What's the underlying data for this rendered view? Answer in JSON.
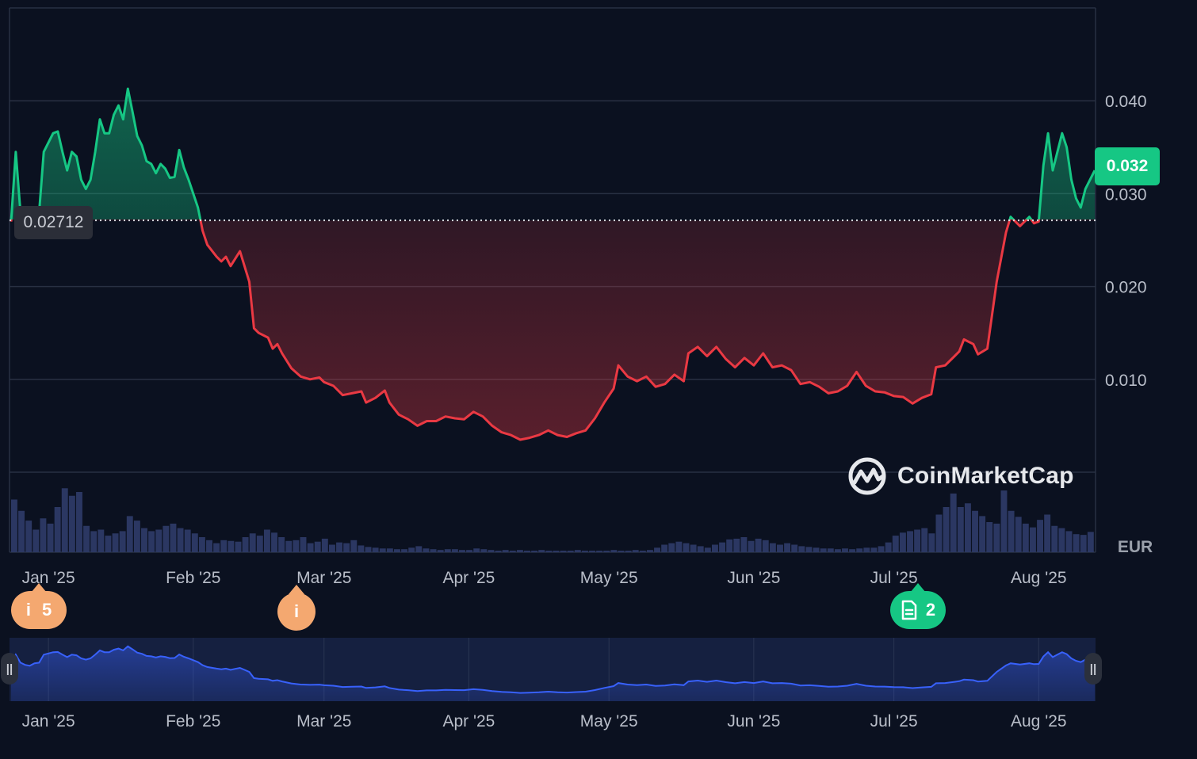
{
  "chart_data": {
    "type": "line",
    "title": "",
    "xlabel": "",
    "ylabel": "",
    "unit_label": "EUR",
    "ylim": [
      0,
      0.05
    ],
    "y_ticks": [
      "0.040",
      "0.030",
      "0.020",
      "0.010"
    ],
    "y_tick_values": [
      0.04,
      0.03,
      0.02,
      0.01
    ],
    "x_start": "2024-12-24",
    "x_end": "2025-08-13",
    "month_labels": [
      {
        "label": "Jan '25",
        "date": "2025-01-01"
      },
      {
        "label": "Feb '25",
        "date": "2025-02-01"
      },
      {
        "label": "Mar '25",
        "date": "2025-03-01"
      },
      {
        "label": "Apr '25",
        "date": "2025-04-01"
      },
      {
        "label": "May '25",
        "date": "2025-05-01"
      },
      {
        "label": "Jun '25",
        "date": "2025-06-01"
      },
      {
        "label": "Jul '25",
        "date": "2025-07-01"
      },
      {
        "label": "Aug '25",
        "date": "2025-08-01"
      }
    ],
    "baseline": {
      "value": 0.02712,
      "label": "0.02712"
    },
    "current_price": {
      "value": 0.0322,
      "label": "0.032"
    },
    "colors": {
      "up": "#16c784",
      "down": "#ea3943",
      "navigator": "#3861fb",
      "background": "#0b1120",
      "grid": "#283042"
    },
    "series": [
      {
        "points": [
          [
            "2024-12-24",
            0.027
          ],
          [
            "2024-12-25",
            0.0345
          ],
          [
            "2024-12-26",
            0.028
          ],
          [
            "2024-12-27",
            0.0262
          ],
          [
            "2024-12-28",
            0.0255
          ],
          [
            "2024-12-29",
            0.0275
          ],
          [
            "2024-12-30",
            0.028
          ],
          [
            "2024-12-31",
            0.0345
          ],
          [
            "2025-01-02",
            0.0365
          ],
          [
            "2025-01-03",
            0.0367
          ],
          [
            "2025-01-04",
            0.0345
          ],
          [
            "2025-01-05",
            0.0325
          ],
          [
            "2025-01-06",
            0.0345
          ],
          [
            "2025-01-07",
            0.034
          ],
          [
            "2025-01-08",
            0.0315
          ],
          [
            "2025-01-09",
            0.0305
          ],
          [
            "2025-01-10",
            0.0315
          ],
          [
            "2025-01-11",
            0.0345
          ],
          [
            "2025-01-12",
            0.038
          ],
          [
            "2025-01-13",
            0.0365
          ],
          [
            "2025-01-14",
            0.0365
          ],
          [
            "2025-01-15",
            0.0385
          ],
          [
            "2025-01-16",
            0.0395
          ],
          [
            "2025-01-17",
            0.038
          ],
          [
            "2025-01-18",
            0.0413
          ],
          [
            "2025-01-19",
            0.0388
          ],
          [
            "2025-01-20",
            0.0362
          ],
          [
            "2025-01-21",
            0.0352
          ],
          [
            "2025-01-22",
            0.0335
          ],
          [
            "2025-01-23",
            0.0332
          ],
          [
            "2025-01-24",
            0.0322
          ],
          [
            "2025-01-25",
            0.0332
          ],
          [
            "2025-01-26",
            0.0327
          ],
          [
            "2025-01-27",
            0.0317
          ],
          [
            "2025-01-28",
            0.0318
          ],
          [
            "2025-01-29",
            0.0347
          ],
          [
            "2025-01-30",
            0.0328
          ],
          [
            "2025-01-31",
            0.0315
          ],
          [
            "2025-02-02",
            0.0285
          ],
          [
            "2025-02-03",
            0.026
          ],
          [
            "2025-02-04",
            0.0245
          ],
          [
            "2025-02-06",
            0.0232
          ],
          [
            "2025-02-07",
            0.0227
          ],
          [
            "2025-02-08",
            0.0232
          ],
          [
            "2025-02-09",
            0.0222
          ],
          [
            "2025-02-10",
            0.023
          ],
          [
            "2025-02-11",
            0.0238
          ],
          [
            "2025-02-13",
            0.0205
          ],
          [
            "2025-02-14",
            0.0155
          ],
          [
            "2025-02-15",
            0.015
          ],
          [
            "2025-02-17",
            0.0145
          ],
          [
            "2025-02-18",
            0.0133
          ],
          [
            "2025-02-19",
            0.0138
          ],
          [
            "2025-02-20",
            0.0128
          ],
          [
            "2025-02-22",
            0.0112
          ],
          [
            "2025-02-24",
            0.0103
          ],
          [
            "2025-02-26",
            0.01
          ],
          [
            "2025-02-28",
            0.0102
          ],
          [
            "2025-03-01",
            0.0097
          ],
          [
            "2025-03-03",
            0.0093
          ],
          [
            "2025-03-05",
            0.0083
          ],
          [
            "2025-03-07",
            0.0085
          ],
          [
            "2025-03-09",
            0.0087
          ],
          [
            "2025-03-10",
            0.0075
          ],
          [
            "2025-03-12",
            0.008
          ],
          [
            "2025-03-14",
            0.0088
          ],
          [
            "2025-03-15",
            0.0075
          ],
          [
            "2025-03-17",
            0.0062
          ],
          [
            "2025-03-19",
            0.0057
          ],
          [
            "2025-03-21",
            0.005
          ],
          [
            "2025-03-23",
            0.0055
          ],
          [
            "2025-03-25",
            0.0055
          ],
          [
            "2025-03-27",
            0.006
          ],
          [
            "2025-03-29",
            0.0058
          ],
          [
            "2025-03-31",
            0.0057
          ],
          [
            "2025-04-02",
            0.0065
          ],
          [
            "2025-04-04",
            0.006
          ],
          [
            "2025-04-06",
            0.005
          ],
          [
            "2025-04-08",
            0.0043
          ],
          [
            "2025-04-10",
            0.004
          ],
          [
            "2025-04-12",
            0.0035
          ],
          [
            "2025-04-14",
            0.0037
          ],
          [
            "2025-04-16",
            0.004
          ],
          [
            "2025-04-18",
            0.0045
          ],
          [
            "2025-04-20",
            0.004
          ],
          [
            "2025-04-22",
            0.0038
          ],
          [
            "2025-04-24",
            0.0042
          ],
          [
            "2025-04-26",
            0.0045
          ],
          [
            "2025-04-28",
            0.0058
          ],
          [
            "2025-04-30",
            0.0075
          ],
          [
            "2025-05-02",
            0.009
          ],
          [
            "2025-05-03",
            0.0115
          ],
          [
            "2025-05-05",
            0.0103
          ],
          [
            "2025-05-07",
            0.0098
          ],
          [
            "2025-05-09",
            0.0103
          ],
          [
            "2025-05-11",
            0.0092
          ],
          [
            "2025-05-13",
            0.0095
          ],
          [
            "2025-05-15",
            0.0105
          ],
          [
            "2025-05-17",
            0.0098
          ],
          [
            "2025-05-18",
            0.0128
          ],
          [
            "2025-05-20",
            0.0135
          ],
          [
            "2025-05-22",
            0.0125
          ],
          [
            "2025-05-24",
            0.0135
          ],
          [
            "2025-05-26",
            0.0122
          ],
          [
            "2025-05-28",
            0.0113
          ],
          [
            "2025-05-30",
            0.0123
          ],
          [
            "2025-06-01",
            0.0115
          ],
          [
            "2025-06-03",
            0.0128
          ],
          [
            "2025-06-05",
            0.0113
          ],
          [
            "2025-06-07",
            0.0115
          ],
          [
            "2025-06-09",
            0.011
          ],
          [
            "2025-06-11",
            0.0095
          ],
          [
            "2025-06-13",
            0.0097
          ],
          [
            "2025-06-15",
            0.0092
          ],
          [
            "2025-06-17",
            0.0085
          ],
          [
            "2025-06-19",
            0.0087
          ],
          [
            "2025-06-21",
            0.0093
          ],
          [
            "2025-06-23",
            0.0108
          ],
          [
            "2025-06-25",
            0.0093
          ],
          [
            "2025-06-27",
            0.0087
          ],
          [
            "2025-06-29",
            0.0086
          ],
          [
            "2025-07-01",
            0.0082
          ],
          [
            "2025-07-03",
            0.0081
          ],
          [
            "2025-07-05",
            0.0074
          ],
          [
            "2025-07-07",
            0.008
          ],
          [
            "2025-07-09",
            0.0084
          ],
          [
            "2025-07-10",
            0.0113
          ],
          [
            "2025-07-12",
            0.0115
          ],
          [
            "2025-07-14",
            0.0125
          ],
          [
            "2025-07-15",
            0.013
          ],
          [
            "2025-07-16",
            0.0143
          ],
          [
            "2025-07-18",
            0.0138
          ],
          [
            "2025-07-19",
            0.0127
          ],
          [
            "2025-07-21",
            0.0133
          ],
          [
            "2025-07-23",
            0.0205
          ],
          [
            "2025-07-25",
            0.0258
          ],
          [
            "2025-07-26",
            0.0275
          ],
          [
            "2025-07-28",
            0.0265
          ],
          [
            "2025-07-30",
            0.0275
          ],
          [
            "2025-07-31",
            0.0268
          ],
          [
            "2025-08-01",
            0.027
          ],
          [
            "2025-08-02",
            0.033
          ],
          [
            "2025-08-03",
            0.0365
          ],
          [
            "2025-08-04",
            0.0325
          ],
          [
            "2025-08-05",
            0.0345
          ],
          [
            "2025-08-06",
            0.0365
          ],
          [
            "2025-08-07",
            0.035
          ],
          [
            "2025-08-08",
            0.0315
          ],
          [
            "2025-08-09",
            0.0295
          ],
          [
            "2025-08-10",
            0.0285
          ],
          [
            "2025-08-11",
            0.0305
          ],
          [
            "2025-08-12",
            0.0315
          ],
          [
            "2025-08-13",
            0.0325
          ]
        ]
      }
    ],
    "volume_series": [
      0.7,
      0.55,
      0.42,
      0.3,
      0.45,
      0.38,
      0.6,
      0.85,
      0.75,
      0.8,
      0.35,
      0.28,
      0.3,
      0.22,
      0.25,
      0.28,
      0.48,
      0.42,
      0.32,
      0.28,
      0.3,
      0.35,
      0.38,
      0.32,
      0.3,
      0.25,
      0.2,
      0.16,
      0.12,
      0.16,
      0.15,
      0.14,
      0.2,
      0.25,
      0.22,
      0.3,
      0.26,
      0.2,
      0.15,
      0.16,
      0.2,
      0.12,
      0.14,
      0.18,
      0.1,
      0.13,
      0.12,
      0.16,
      0.09,
      0.07,
      0.06,
      0.05,
      0.05,
      0.04,
      0.04,
      0.06,
      0.08,
      0.05,
      0.04,
      0.03,
      0.04,
      0.04,
      0.03,
      0.03,
      0.05,
      0.04,
      0.03,
      0.02,
      0.03,
      0.02,
      0.03,
      0.02,
      0.02,
      0.03,
      0.02,
      0.02,
      0.02,
      0.02,
      0.03,
      0.02,
      0.02,
      0.02,
      0.02,
      0.03,
      0.02,
      0.02,
      0.03,
      0.02,
      0.03,
      0.06,
      0.1,
      0.12,
      0.14,
      0.12,
      0.1,
      0.08,
      0.06,
      0.1,
      0.13,
      0.17,
      0.18,
      0.2,
      0.15,
      0.18,
      0.16,
      0.12,
      0.1,
      0.12,
      0.1,
      0.08,
      0.07,
      0.06,
      0.05,
      0.05,
      0.04,
      0.05,
      0.04,
      0.05,
      0.06,
      0.06,
      0.08,
      0.13,
      0.22,
      0.26,
      0.28,
      0.3,
      0.32,
      0.25,
      0.5,
      0.6,
      0.78,
      0.6,
      0.65,
      0.55,
      0.48,
      0.4,
      0.38,
      0.82,
      0.55,
      0.47,
      0.38,
      0.33,
      0.43,
      0.5,
      0.35,
      0.32,
      0.28,
      0.24,
      0.23,
      0.27
    ],
    "annotations": [
      {
        "label": "i",
        "count": "5",
        "date": "2025-01-01"
      },
      {
        "label": "i",
        "count": "",
        "date": "2025-02-28"
      },
      {
        "label": "doc",
        "count": "2",
        "date": "2025-07-01"
      }
    ]
  },
  "watermark": {
    "brand": "CoinMarketCap",
    "icon": "coinmarketcap-logo-icon"
  },
  "navigator": {
    "handle_left_icon": "drag-handle-icon",
    "handle_right_icon": "drag-handle-icon",
    "handle_glyph": "||"
  }
}
